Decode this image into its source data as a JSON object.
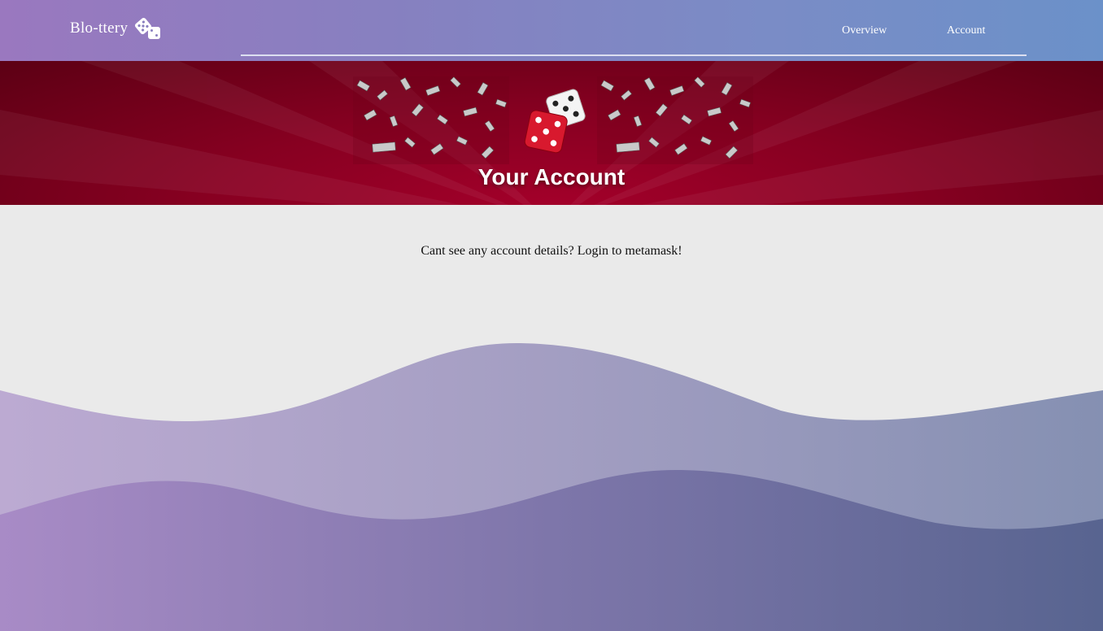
{
  "header": {
    "brand": "Blo-ttery",
    "brand_icon": "dice-icon",
    "nav": [
      {
        "label": "Overview"
      },
      {
        "label": "Account"
      }
    ]
  },
  "banner": {
    "title": "Your Account",
    "image": "dice-with-money-icon"
  },
  "main": {
    "message": "Cant see any account details? Login to metamask!"
  },
  "colors": {
    "header_start": "#9a78bf",
    "header_end": "#6b91c9",
    "banner": "#870021",
    "background": "#eaeaea",
    "wave_light": "#a8a2c8",
    "wave_dark": "#6a6aa0"
  }
}
